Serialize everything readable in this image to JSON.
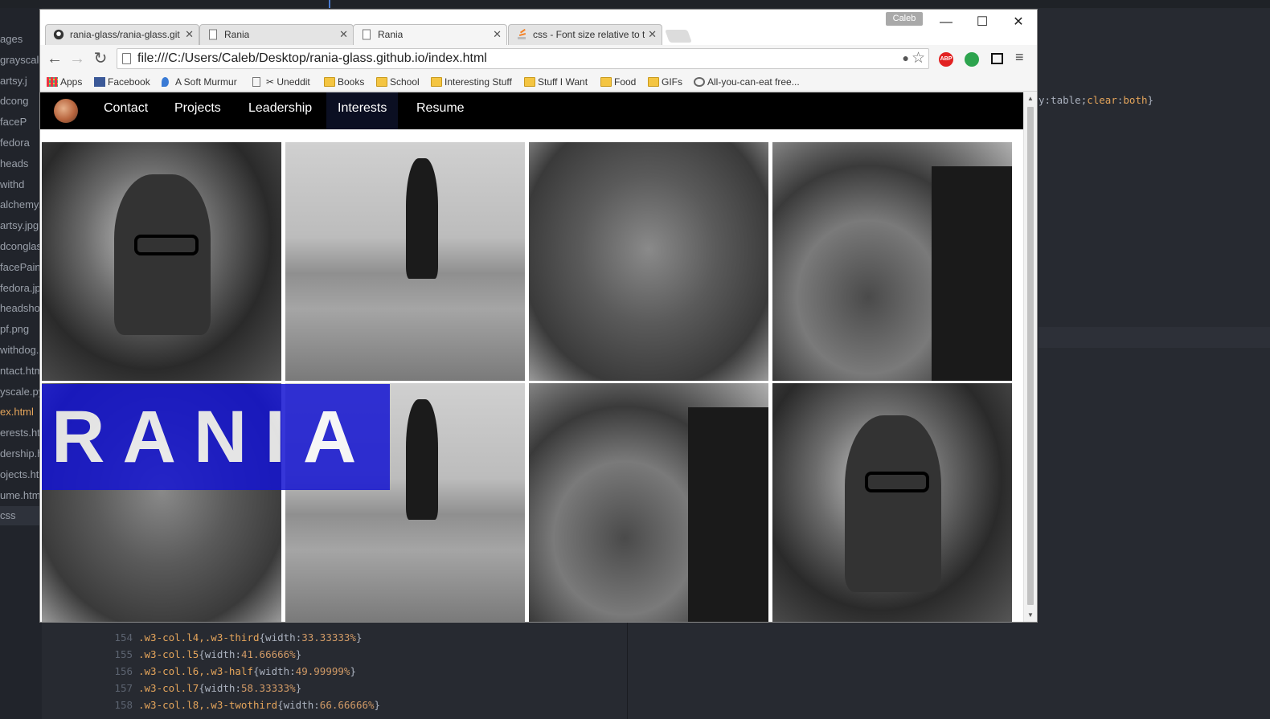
{
  "editor": {
    "file_tree": [
      {
        "label": "ages"
      },
      {
        "label": "grayscale"
      },
      {
        "label": "artsy.j"
      },
      {
        "label": "dcong"
      },
      {
        "label": "faceP"
      },
      {
        "label": "fedora"
      },
      {
        "label": "heads"
      },
      {
        "label": "withd"
      },
      {
        "label": "alchemy."
      },
      {
        "label": "artsy.jpg"
      },
      {
        "label": "dconglas"
      },
      {
        "label": "facePaint"
      },
      {
        "label": "fedora.jp"
      },
      {
        "label": "headshot"
      },
      {
        "label": "pf.png"
      },
      {
        "label": "withdog."
      },
      {
        "label": "ntact.htm"
      },
      {
        "label": "yscale.py"
      },
      {
        "label": "ex.html"
      },
      {
        "label": "erests.htm"
      },
      {
        "label": "dership.h"
      },
      {
        "label": "ojects.htm"
      },
      {
        "label": "ume.htm"
      },
      {
        "label": "css"
      }
    ],
    "code_lines": [
      {
        "num": "154",
        "selector": ".w3-col.l4,.w3-third",
        "prop": "width",
        "value": "33.33333%"
      },
      {
        "num": "155",
        "selector": ".w3-col.l5",
        "prop": "width",
        "value": "41.66666%"
      },
      {
        "num": "156",
        "selector": ".w3-col.l6,.w3-half",
        "prop": "width",
        "value": "49.99999%"
      },
      {
        "num": "157",
        "selector": ".w3-col.l7",
        "prop": "width",
        "value": "58.33333%"
      },
      {
        "num": "158",
        "selector": ".w3-col.l8,.w3-twothird",
        "prop": "width",
        "value": "66.66666%"
      }
    ],
    "right_code": {
      "prefix": "y:",
      "value1": "table",
      "sep": ";",
      "prop": "clear",
      "colon": ":",
      "value2": "both",
      "close": "}"
    }
  },
  "browser": {
    "profile_name": "Caleb",
    "tabs": [
      {
        "title": "rania-glass/rania-glass.git",
        "close": "✕"
      },
      {
        "title": "Rania",
        "close": "✕"
      },
      {
        "title": "Rania",
        "close": "✕"
      },
      {
        "title": "css - Font size relative to t",
        "close": "✕"
      }
    ],
    "window_controls": {
      "minimize": "—",
      "maximize": "☐",
      "close": "✕"
    },
    "nav": {
      "back": "←",
      "forward": "→",
      "reload": "↻"
    },
    "url": "file:///C:/Users/Caleb/Desktop/rania-glass.github.io/index.html",
    "extensions": {
      "abp": "ABP",
      "menu": "≡",
      "star": "☆"
    },
    "bookmarks": [
      {
        "label": "Apps",
        "icon": "apps-grid-icon"
      },
      {
        "label": "Facebook",
        "icon": "facebook-icon"
      },
      {
        "label": "A Soft Murmur",
        "icon": "droplet-icon"
      },
      {
        "label": "✂ Uneddit",
        "icon": "page-icon"
      },
      {
        "label": "Books",
        "icon": "folder-icon"
      },
      {
        "label": "School",
        "icon": "folder-icon"
      },
      {
        "label": "Interesting Stuff",
        "icon": "folder-icon"
      },
      {
        "label": "Stuff I Want",
        "icon": "folder-icon"
      },
      {
        "label": "Food",
        "icon": "folder-icon"
      },
      {
        "label": "GIFs",
        "icon": "folder-icon"
      },
      {
        "label": "All-you-can-eat free...",
        "icon": "globe-icon"
      }
    ]
  },
  "site": {
    "nav_links": [
      {
        "label": "Contact"
      },
      {
        "label": "Projects"
      },
      {
        "label": "Leadership"
      },
      {
        "label": "Interests"
      },
      {
        "label": "Resume"
      }
    ],
    "active_link": "Interests",
    "banner_title": "RANIA",
    "banner_color": "#1414d2",
    "scroll_up": "▲",
    "scroll_down": "▼"
  }
}
